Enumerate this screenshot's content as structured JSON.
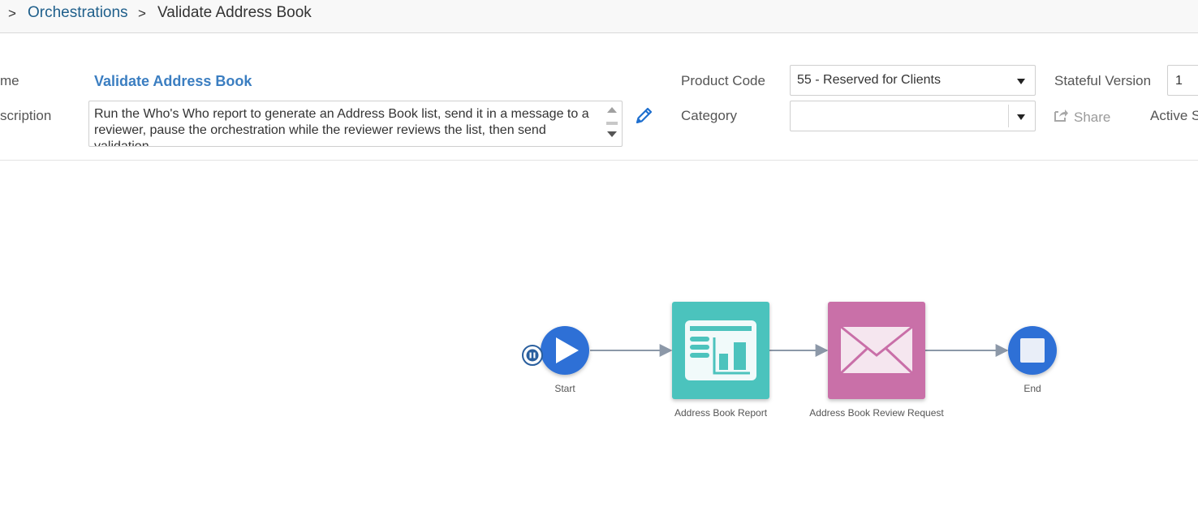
{
  "breadcrumb": {
    "separator": ">",
    "parent": "Orchestrations",
    "current": "Validate Address Book"
  },
  "form": {
    "name_label": "me",
    "name_value": "Validate Address Book",
    "description_label": "scription",
    "description_value": "Run the Who's Who report to generate an Address Book list, send it in a message to a reviewer, pause the orchestration while the reviewer reviews the list, then send validation",
    "product_code_label": "Product Code",
    "product_code_value": "55 - Reserved for Clients",
    "category_label": "Category",
    "category_value": "",
    "stateful_version_label": "Stateful Version",
    "stateful_version_value": "1",
    "share_label": "Share",
    "active_label": "Active S"
  },
  "diagram": {
    "nodes": [
      {
        "id": "start",
        "label": "Start",
        "icon": "play-icon"
      },
      {
        "id": "report",
        "label": "Address Book Report",
        "icon": "report-icon"
      },
      {
        "id": "review",
        "label": "Address Book Review Request",
        "icon": "envelope-icon"
      },
      {
        "id": "end",
        "label": "End",
        "icon": "stop-icon"
      }
    ]
  },
  "colors": {
    "link": "#1f5f8b",
    "name_value": "#3b7ec1",
    "start_end_node": "#2d6fd6",
    "report_node": "#4cc3bd",
    "review_node": "#c96fa8",
    "connector": "#8c98a8"
  }
}
